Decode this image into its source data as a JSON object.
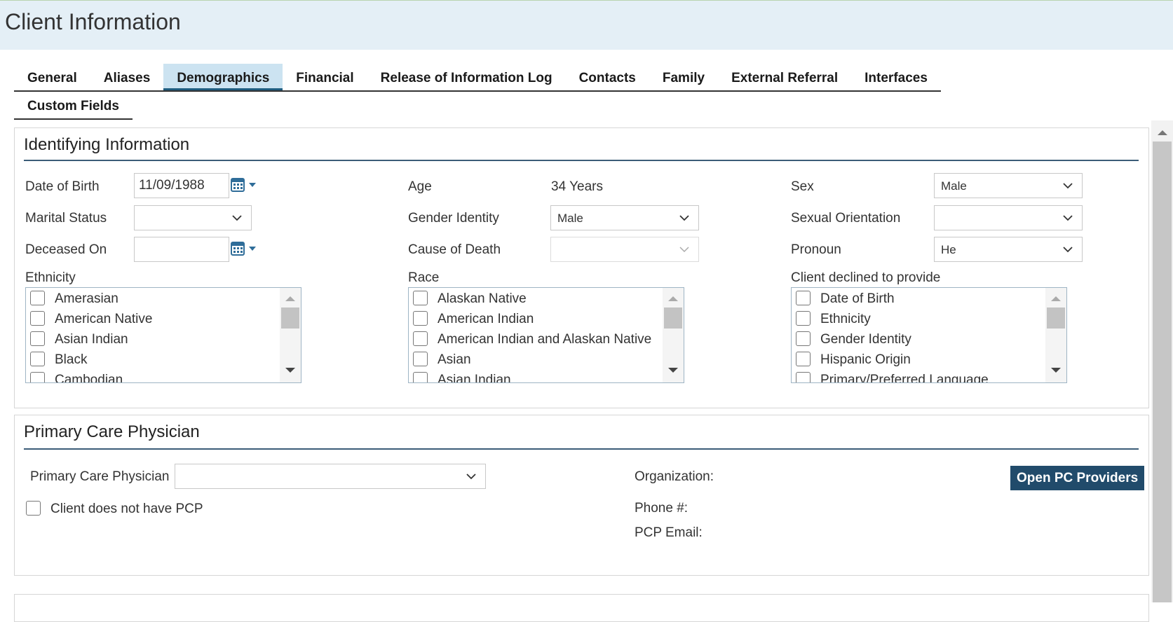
{
  "window": {
    "title": "Client Information"
  },
  "tabs": [
    {
      "label": "General",
      "active": false
    },
    {
      "label": "Aliases",
      "active": false
    },
    {
      "label": "Demographics",
      "active": true
    },
    {
      "label": "Financial",
      "active": false
    },
    {
      "label": "Release of Information Log",
      "active": false
    },
    {
      "label": "Contacts",
      "active": false
    },
    {
      "label": "Family",
      "active": false
    },
    {
      "label": "External Referral",
      "active": false
    },
    {
      "label": "Interfaces",
      "active": false
    },
    {
      "label": "Custom Fields",
      "active": false
    }
  ],
  "identifying": {
    "title": "Identifying Information",
    "dob_label": "Date of Birth",
    "dob_value": "11/09/1988",
    "age_label": "Age",
    "age_value": "34 Years",
    "sex_label": "Sex",
    "sex_value": "Male",
    "marital_label": "Marital Status",
    "marital_value": "",
    "gender_identity_label": "Gender Identity",
    "gender_identity_value": "Male",
    "sexual_orientation_label": "Sexual Orientation",
    "sexual_orientation_value": "",
    "deceased_label": "Deceased On",
    "deceased_value": "",
    "cause_of_death_label": "Cause of Death",
    "cause_of_death_value": "",
    "pronoun_label": "Pronoun",
    "pronoun_value": "He",
    "ethnicity_label": "Ethnicity",
    "ethnicity_items": [
      "Amerasian",
      "American Native",
      "Asian Indian",
      "Black",
      "Cambodian"
    ],
    "race_label": "Race",
    "race_items": [
      "Alaskan Native",
      "American Indian",
      "American Indian and Alaskan Native",
      "Asian",
      "Asian Indian"
    ],
    "declined_label": "Client declined to provide",
    "declined_items": [
      "Date of Birth",
      "Ethnicity",
      "Gender Identity",
      "Hispanic Origin",
      "Primary/Preferred Language"
    ]
  },
  "pcp": {
    "title": "Primary Care Physician",
    "pcp_label": "Primary Care Physician",
    "pcp_value": "",
    "no_pcp_label": "Client does not have PCP",
    "organization_label": "Organization:",
    "phone_label": "Phone #:",
    "email_label": "PCP Email:",
    "open_button": "Open PC Providers"
  },
  "colors": {
    "title_bar": "#e4eff6",
    "active_tab": "#cce3f1",
    "section_rule": "#3b5d78",
    "primary_button": "#214b6b"
  },
  "icons": [
    "calendar-icon",
    "chevron-down-icon",
    "scroll-up-icon",
    "scroll-down-icon"
  ]
}
